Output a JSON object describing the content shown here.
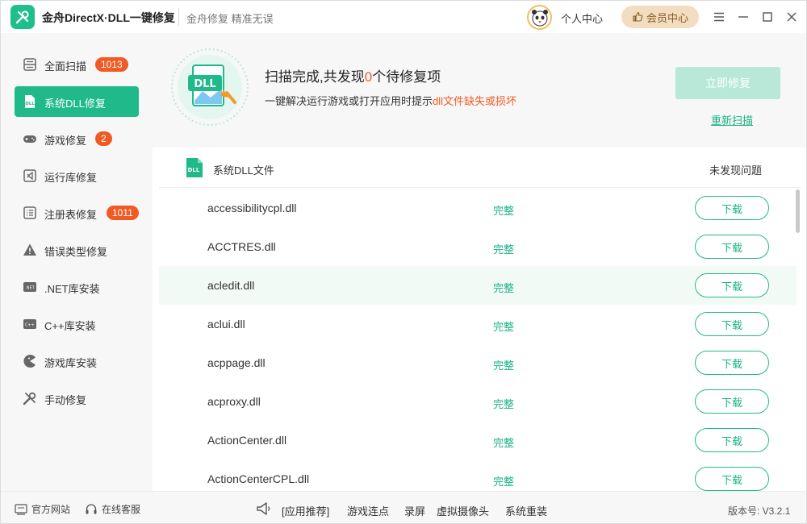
{
  "titlebar": {
    "app_title": "金舟DirectX·DLL一键修复",
    "slogan": "金舟修复 精准无误",
    "user_center": "个人中心",
    "vip_center": "会员中心"
  },
  "sidebar": {
    "items": [
      {
        "label": "全面扫描",
        "badge": "1013",
        "icon": "scan-icon",
        "active": false
      },
      {
        "label": "系统DLL修复",
        "badge": "",
        "icon": "dll-icon",
        "active": true
      },
      {
        "label": "游戏修复",
        "badge": "2",
        "icon": "gamepad-icon",
        "active": false
      },
      {
        "label": "运行库修复",
        "badge": "",
        "icon": "visual-studio-icon",
        "active": false
      },
      {
        "label": "注册表修复",
        "badge": "1011",
        "icon": "registry-list-icon",
        "active": false
      },
      {
        "label": "错误类型修复",
        "badge": "",
        "icon": "warning-icon",
        "active": false
      },
      {
        "label": ".NET库安装",
        "badge": "",
        "icon": "dotnet-icon",
        "active": false
      },
      {
        "label": "C++库安装",
        "badge": "",
        "icon": "cpp-icon",
        "active": false
      },
      {
        "label": "游戏库安装",
        "badge": "",
        "icon": "pacman-icon",
        "active": false
      },
      {
        "label": "手动修复",
        "badge": "",
        "icon": "tools-icon",
        "active": false
      }
    ]
  },
  "hero": {
    "title_prefix": "扫描完成,共发现",
    "title_count": "0",
    "title_suffix": "个待修复项",
    "sub_prefix": "一键解决运行游戏或打开应用时提示",
    "sub_highlight": "dll文件缺失或损坏",
    "graphic_text": "DLL",
    "fix_now": "立即修复",
    "rescan": "重新扫描"
  },
  "list": {
    "header_title": "系统DLL文件",
    "header_status": "未发现问题",
    "header_icon_text": "DLL",
    "rows": [
      {
        "name": "accessibilitycpl.dll",
        "status": "完整",
        "action": "下载"
      },
      {
        "name": "ACCTRES.dll",
        "status": "完整",
        "action": "下载"
      },
      {
        "name": "acledit.dll",
        "status": "完整",
        "action": "下载"
      },
      {
        "name": "aclui.dll",
        "status": "完整",
        "action": "下载"
      },
      {
        "name": "acppage.dll",
        "status": "完整",
        "action": "下载"
      },
      {
        "name": "acproxy.dll",
        "status": "完整",
        "action": "下载"
      },
      {
        "name": "ActionCenter.dll",
        "status": "完整",
        "action": "下载"
      },
      {
        "name": "ActionCenterCPL.dll",
        "status": "完整",
        "action": "下载"
      }
    ]
  },
  "footer": {
    "official_site": "官方网站",
    "online_service": "在线客服",
    "links": [
      "[应用推荐]",
      "游戏连点",
      "录屏",
      "虚拟摄像头",
      "系统重装"
    ],
    "version": "版本号: V3.2.1"
  },
  "colors": {
    "accent": "#1fb98a",
    "highlight": "#f15a24",
    "vip_bg": "#f3ddc1"
  }
}
